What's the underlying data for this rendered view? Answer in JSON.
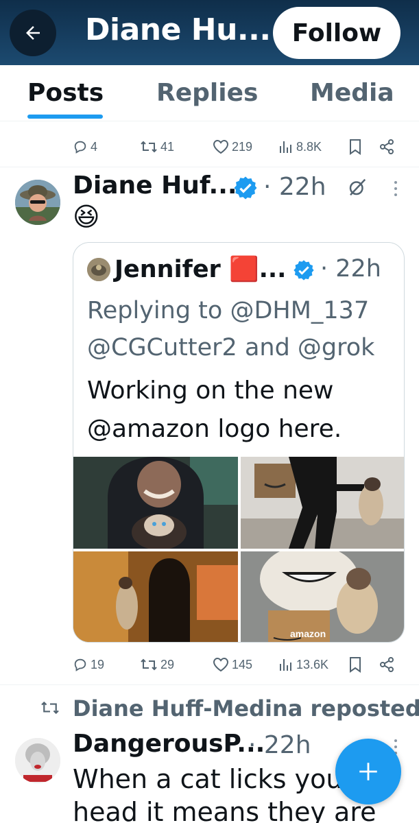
{
  "header": {
    "title": "Diane Hu...",
    "follow_label": "Follow"
  },
  "tabs": [
    {
      "label": "Posts",
      "active": true
    },
    {
      "label": "Replies",
      "active": false
    },
    {
      "label": "Media",
      "active": false
    }
  ],
  "top_post_actions": {
    "replies": "4",
    "reposts": "41",
    "likes": "219",
    "views": "8.8K"
  },
  "post": {
    "author": "Diane Huf...",
    "time": "· 22h",
    "text": "😆",
    "quote": {
      "author": "Jennifer 🟥...",
      "time": "· 22h",
      "replying_line1": "Replying to @DHM_137",
      "replying_line2": "@CGCutter2 and @grok",
      "text_line1": "Working on the new",
      "text_line2": "@amazon logo here."
    },
    "media_text": "amazon",
    "actions": {
      "replies": "19",
      "reposts": "29",
      "likes": "145",
      "views": "13.6K"
    }
  },
  "next_post": {
    "repost_label": "Diane Huff-Medina reposted",
    "author": "DangerousP...",
    "time": "· 22h",
    "text_line1": "When a cat licks your",
    "text_line2": "head it means they are"
  },
  "colors": {
    "accent": "#1d9bf0",
    "header_bg": "#163a5c",
    "muted": "#536471"
  }
}
